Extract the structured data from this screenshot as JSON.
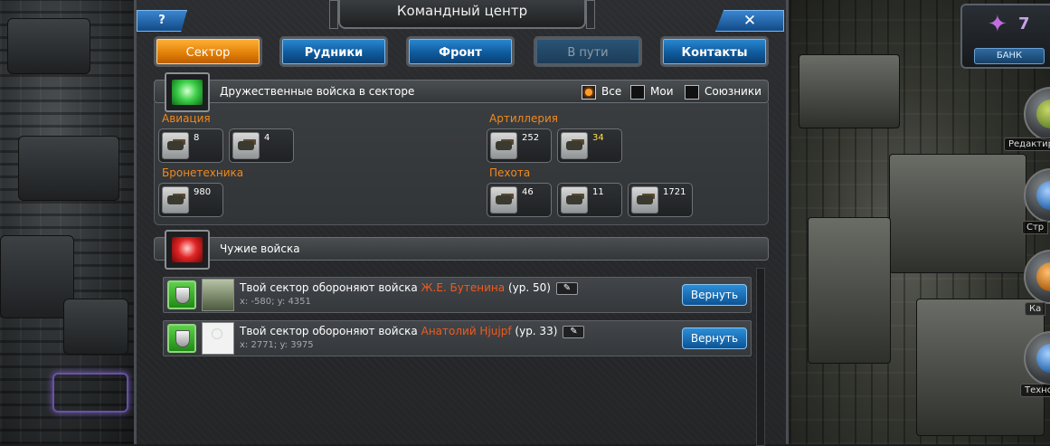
{
  "window": {
    "title": "Командный центр",
    "help_label": "?",
    "close_label": "✕"
  },
  "tabs": [
    {
      "label": "Сектор",
      "state": "active"
    },
    {
      "label": "Рудники",
      "state": "normal"
    },
    {
      "label": "Фронт",
      "state": "normal"
    },
    {
      "label": "В пути",
      "state": "disabled"
    },
    {
      "label": "Контакты",
      "state": "normal"
    }
  ],
  "friendly": {
    "title": "Дружественные войска в секторе",
    "filters": [
      {
        "label": "Все",
        "checked": true
      },
      {
        "label": "Мои",
        "checked": false
      },
      {
        "label": "Союзники",
        "checked": false
      }
    ],
    "categories": [
      {
        "name": "Авиация",
        "units": [
          {
            "count": "8"
          },
          {
            "count": "4"
          }
        ]
      },
      {
        "name": "Бронетехника",
        "units": [
          {
            "count": "980"
          }
        ]
      },
      {
        "name": "Артиллерия",
        "units": [
          {
            "count": "252"
          },
          {
            "count": "34",
            "highlight": "#ffe23a"
          }
        ]
      },
      {
        "name": "Пехота",
        "units": [
          {
            "count": "46"
          },
          {
            "count": "11"
          },
          {
            "count": "1721"
          }
        ]
      }
    ]
  },
  "foreign": {
    "title": "Чужие войска",
    "rows": [
      {
        "prefix": "Твой сектор обороняют войска",
        "name": "Ж.Е. Бутенина",
        "level": "(ур. 50)",
        "coords": "x: -580; y: 4351",
        "button": "Вернуть"
      },
      {
        "prefix": "Твой сектор обороняют войска",
        "name": "Анатолий Hjujpf",
        "level": "(ур. 33)",
        "coords": "x: 2771; y: 3975",
        "button": "Вернуть"
      }
    ]
  },
  "hud": {
    "bank_count": "7",
    "bank_label": "БАНК",
    "side_labels": [
      "Редактир",
      "Стр",
      "Ка",
      "Техно"
    ]
  },
  "colors": {
    "accent_orange": "#f08a1c",
    "name_orange": "#f05a1c",
    "tab_blue": "#0f5a9c",
    "tab_active": "#e07d06"
  }
}
